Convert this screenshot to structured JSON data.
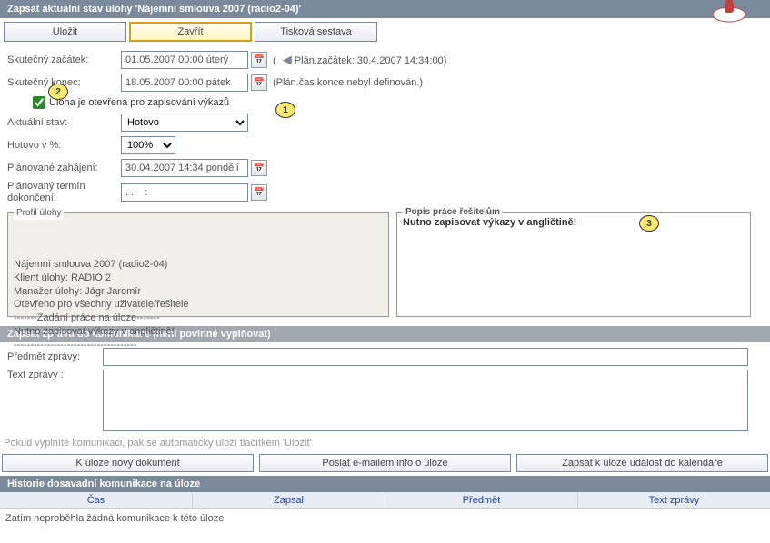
{
  "header": {
    "title": "Zapsat aktuální stav úlohy 'Nájemní smlouva 2007 (radio2-04)'"
  },
  "buttons": {
    "save": "Uložit",
    "close": "Zavřít",
    "report": "Tisková sestava"
  },
  "form": {
    "actual_start_label": "Skutečný začátek:",
    "actual_start_value": "01.05.2007 00:00 úterý",
    "actual_start_side": "Plán.začátek: 30.4.2007 14:34:00)",
    "actual_end_label": "Skutečný konec:",
    "actual_end_value": "18.05.2007 00:00 pátek",
    "actual_end_side": "(Plán.čas konce nebyl definován.)",
    "open_checkbox_label": "Úloha je otevřená pro zapisování výkazů",
    "status_label": "Aktuální stav:",
    "status_value": "Hotovo",
    "done_pct_label": "Hotovo v %:",
    "done_pct_value": "100%",
    "planned_start_label": "Plánované zahájení:",
    "planned_start_value": "30.04.2007 14:34 pondělí",
    "planned_end_label": "Plánovaný termín dokončení:",
    "planned_end_value": ". .    :"
  },
  "callouts": {
    "c1": "1",
    "c2": "2",
    "c3": "3"
  },
  "profile": {
    "legend": "Profil úlohy",
    "text": "Nájemní smlouva 2007 (radio2-04)\nKlient úlohy: RADIO 2\nManažer úlohy: Jágr Jaromír\nOtevřeno pro všechny uživatele/řešitele\n-------Zadání práce na úloze-------\nNutno zapisovat výkazy v angličtině!\n-------------------------------------"
  },
  "description": {
    "legend": "Popis práce řešitelům",
    "text": "Nutno zapisovat výkazy v angličtině!"
  },
  "comm": {
    "section_title": "Zapsat zprávu do komunikace (není povinné vyplňovat)",
    "subject_label": "Předmět zprávy:",
    "text_label": "Text zprávy :",
    "hint": "Pokud vyplníte komunikaci, pak se automaticky uloží tlačítkem 'Uložit'"
  },
  "actions": {
    "new_doc": "K úloze nový dokument",
    "send_email": "Poslat e-mailem info o úloze",
    "calendar": "Zapsat k úloze událost do kalendáře"
  },
  "history": {
    "title": "Historie dosavadní komunikace na úloze",
    "cols": {
      "time": "Čas",
      "author": "Zapsal",
      "subject": "Předmět",
      "text": "Text zprávy"
    },
    "empty": "Zatím neproběhla žádná komunikace k této úloze"
  }
}
